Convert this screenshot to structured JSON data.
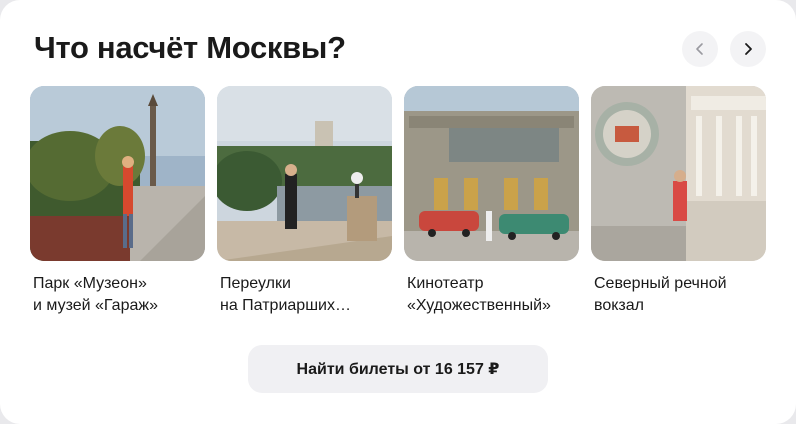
{
  "section": {
    "title": "Что насчёт Москвы?",
    "prev_icon": "chevron-left-icon",
    "next_icon": "chevron-right-icon"
  },
  "places": [
    {
      "caption": "Парк «Музеон»\nи музей «Гараж»",
      "photo": "park-muzeon-photo"
    },
    {
      "caption": "Переулки\nна Патриарших…",
      "photo": "patriarshie-lanes-photo"
    },
    {
      "caption": "Кинотеатр\n«Художественный»",
      "photo": "khudozhestvenny-cinema-photo"
    },
    {
      "caption": "Северный речной\nвокзал",
      "photo": "river-station-photo"
    }
  ],
  "cta": {
    "label": "Найти билеты от 16 157 ₽"
  },
  "colors": {
    "title": "#1a1a1a",
    "button_bg": "#f0f0f3",
    "card_bg": "#ffffff"
  }
}
